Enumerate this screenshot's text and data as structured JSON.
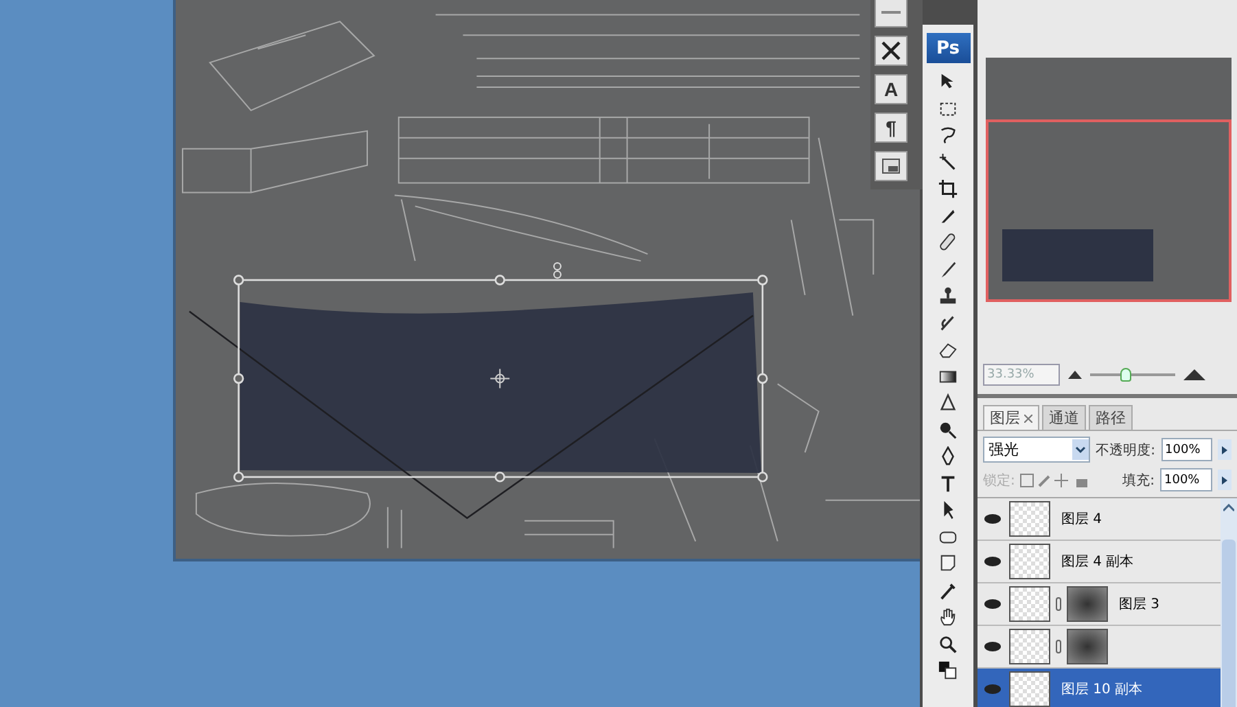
{
  "char_panel": {
    "glyphs": [
      "A",
      "¶"
    ]
  },
  "toolbox": {
    "logo": "Ps"
  },
  "navigator": {
    "zoom": "33.33%",
    "zoom_slider": {
      "level": 0.42
    }
  },
  "layers_panel": {
    "tabs": [
      {
        "label": "图层",
        "selected": true
      },
      {
        "label": "通道",
        "selected": false
      },
      {
        "label": "路径",
        "selected": false
      }
    ],
    "blend_mode": "强光",
    "opacity_label": "不透明度:",
    "opacity": "100%",
    "lock_label": "锁定:",
    "fill_label": "填充:",
    "fill": "100%",
    "layers": [
      {
        "name": "图层 4",
        "visible": true,
        "selected": false,
        "kind": "plain"
      },
      {
        "name": "图层 4 副本",
        "visible": true,
        "selected": false,
        "kind": "plain"
      },
      {
        "name": "图层 3",
        "visible": true,
        "selected": false,
        "kind": "masked"
      },
      {
        "visible": true,
        "selected": false,
        "kind": "masked"
      },
      {
        "name": "图层 10 副本",
        "visible": true,
        "selected": true,
        "kind": "plain"
      }
    ]
  }
}
